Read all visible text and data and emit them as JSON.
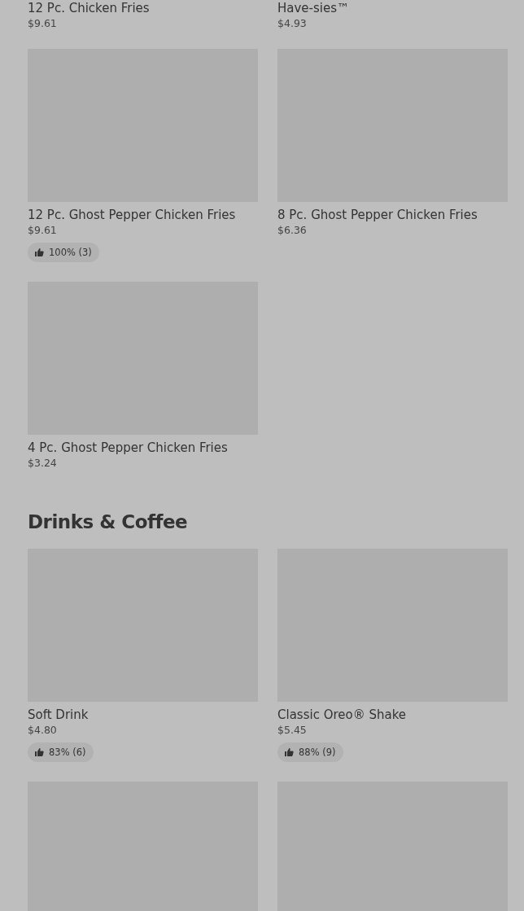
{
  "sections": [
    {
      "items": [
        {
          "kind": "cut",
          "name": "12 Pc. Chicken Fries",
          "price": "$9.61"
        },
        {
          "kind": "cut",
          "name": "Have-sies™",
          "price": "$4.93"
        },
        {
          "kind": "full",
          "name": "12 Pc. Ghost Pepper Chicken Fries",
          "price": "$9.61",
          "rating": "100% (3)"
        },
        {
          "kind": "full",
          "name": "8 Pc. Ghost Pepper Chicken Fries",
          "price": "$6.36"
        },
        {
          "kind": "full",
          "name": "4 Pc. Ghost Pepper Chicken Fries",
          "price": "$3.24"
        }
      ]
    },
    {
      "title": "Drinks & Coffee",
      "items": [
        {
          "kind": "full",
          "name": "Soft Drink",
          "price": "$4.80",
          "rating": "83% (6)"
        },
        {
          "kind": "full",
          "name": "Classic Oreo® Shake",
          "price": "$5.45",
          "rating": "88% (9)"
        },
        {
          "kind": "picture"
        },
        {
          "kind": "picture"
        }
      ]
    }
  ]
}
